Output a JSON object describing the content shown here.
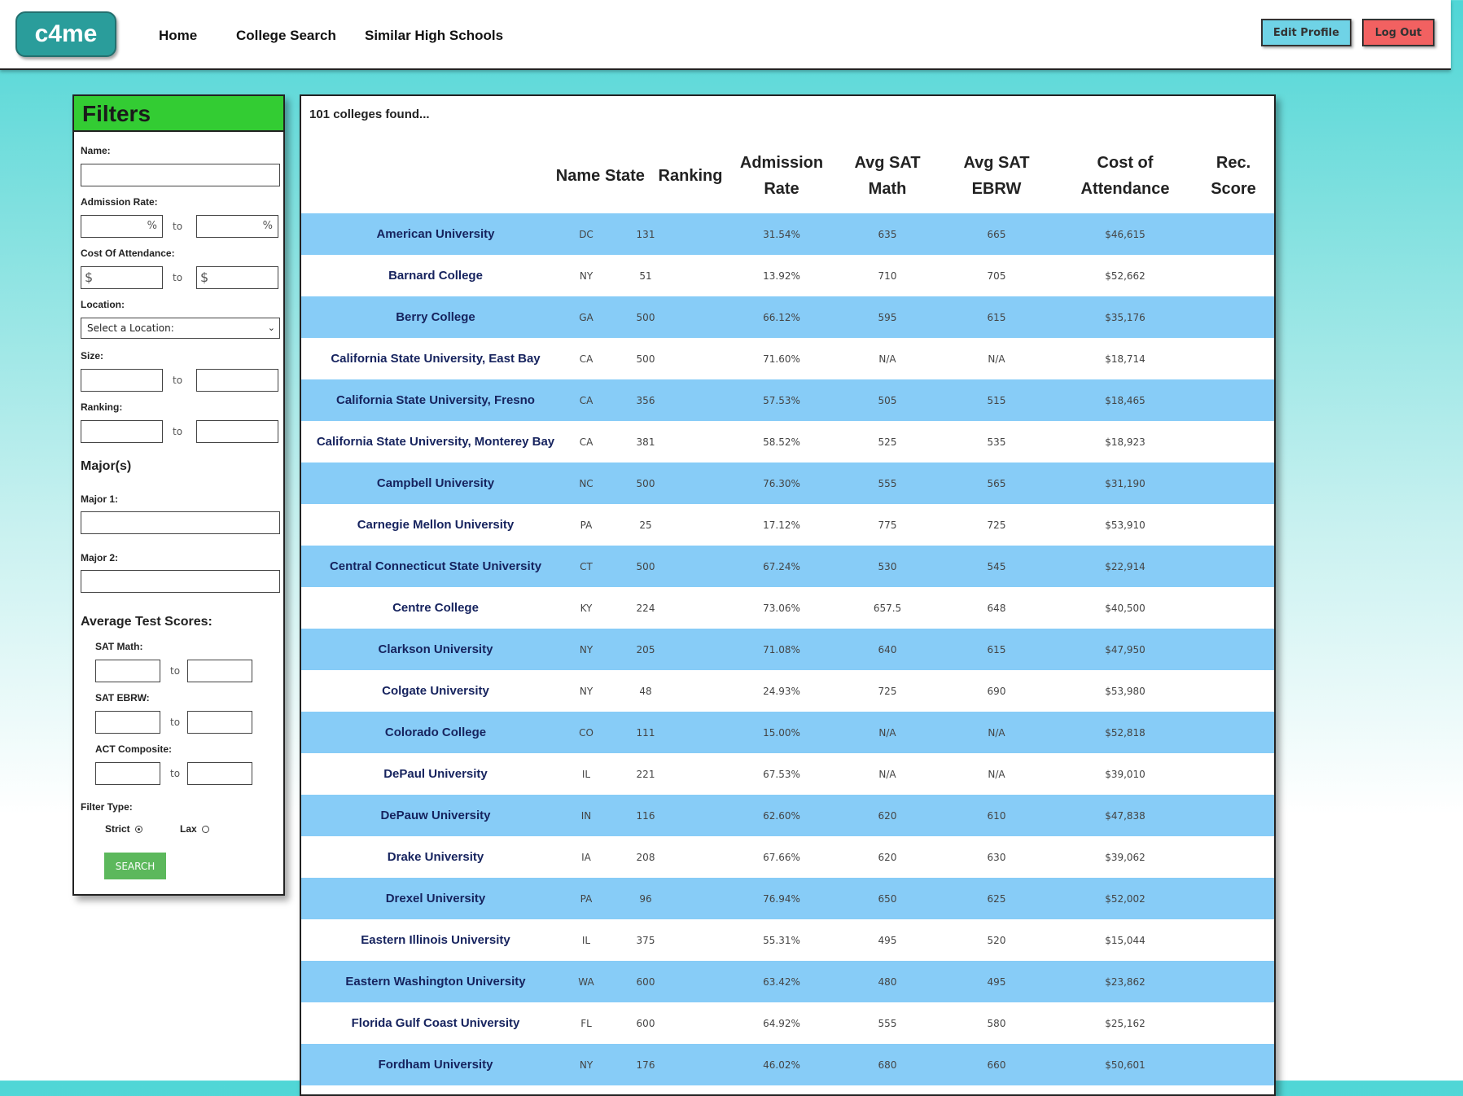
{
  "nav": {
    "logo": "c4me",
    "links": [
      "Home",
      "College Search",
      "Similar High Schools"
    ],
    "edit_profile": "Edit Profile",
    "log_out": "Log Out"
  },
  "filters": {
    "title": "Filters",
    "name_label": "Name:",
    "admission_label": "Admission Rate:",
    "percent": "%",
    "to": "to",
    "cost_label": "Cost Of Attendance:",
    "dollar": "$",
    "location_label": "Location:",
    "location_value": "Select a Location:",
    "size_label": "Size:",
    "ranking_label": "Ranking:",
    "majors_label": "Major(s)",
    "major1_label": "Major 1:",
    "major2_label": "Major 2:",
    "scores_label": "Average Test Scores:",
    "sat_math_label": "SAT Math:",
    "sat_ebrw_label": "SAT EBRW:",
    "act_label": "ACT Composite:",
    "filter_type_label": "Filter Type:",
    "strict": "Strict",
    "lax": "Lax",
    "search": "SEARCH"
  },
  "results": {
    "found": "101 colleges found...",
    "headers": {
      "name": "Name",
      "state": "State",
      "ranking": "Ranking",
      "admission1": "Admission",
      "admission2": "Rate",
      "math1": "Avg SAT",
      "math2": "Math",
      "ebrw1": "Avg SAT",
      "ebrw2": "EBRW",
      "cost1": "Cost of",
      "cost2": "Attendance",
      "rec1": "Rec.",
      "rec2": "Score"
    },
    "rows": [
      [
        "American University",
        "DC",
        "131",
        "31.54%",
        "635",
        "665",
        "$46,615",
        ""
      ],
      [
        "Barnard College",
        "NY",
        "51",
        "13.92%",
        "710",
        "705",
        "$52,662",
        ""
      ],
      [
        "Berry College",
        "GA",
        "500",
        "66.12%",
        "595",
        "615",
        "$35,176",
        ""
      ],
      [
        "California State University, East Bay",
        "CA",
        "500",
        "71.60%",
        "N/A",
        "N/A",
        "$18,714",
        ""
      ],
      [
        "California State University, Fresno",
        "CA",
        "356",
        "57.53%",
        "505",
        "515",
        "$18,465",
        ""
      ],
      [
        "California State University, Monterey Bay",
        "CA",
        "381",
        "58.52%",
        "525",
        "535",
        "$18,923",
        ""
      ],
      [
        "Campbell University",
        "NC",
        "500",
        "76.30%",
        "555",
        "565",
        "$31,190",
        ""
      ],
      [
        "Carnegie Mellon University",
        "PA",
        "25",
        "17.12%",
        "775",
        "725",
        "$53,910",
        ""
      ],
      [
        "Central Connecticut State University",
        "CT",
        "500",
        "67.24%",
        "530",
        "545",
        "$22,914",
        ""
      ],
      [
        "Centre College",
        "KY",
        "224",
        "73.06%",
        "657.5",
        "648",
        "$40,500",
        ""
      ],
      [
        "Clarkson University",
        "NY",
        "205",
        "71.08%",
        "640",
        "615",
        "$47,950",
        ""
      ],
      [
        "Colgate University",
        "NY",
        "48",
        "24.93%",
        "725",
        "690",
        "$53,980",
        ""
      ],
      [
        "Colorado College",
        "CO",
        "111",
        "15.00%",
        "N/A",
        "N/A",
        "$52,818",
        ""
      ],
      [
        "DePaul University",
        "IL",
        "221",
        "67.53%",
        "N/A",
        "N/A",
        "$39,010",
        ""
      ],
      [
        "DePauw University",
        "IN",
        "116",
        "62.60%",
        "620",
        "610",
        "$47,838",
        ""
      ],
      [
        "Drake University",
        "IA",
        "208",
        "67.66%",
        "620",
        "630",
        "$39,062",
        ""
      ],
      [
        "Drexel University",
        "PA",
        "96",
        "76.94%",
        "650",
        "625",
        "$52,002",
        ""
      ],
      [
        "Eastern Illinois University",
        "IL",
        "375",
        "55.31%",
        "495",
        "520",
        "$15,044",
        ""
      ],
      [
        "Eastern Washington University",
        "WA",
        "600",
        "63.42%",
        "480",
        "495",
        "$23,862",
        ""
      ],
      [
        "Florida Gulf Coast University",
        "FL",
        "600",
        "64.92%",
        "555",
        "580",
        "$25,162",
        ""
      ],
      [
        "Fordham University",
        "NY",
        "176",
        "46.02%",
        "680",
        "660",
        "$50,601",
        ""
      ]
    ]
  },
  "colors": {
    "row_blue": "#87ccf7",
    "filters_header": "#33cc33",
    "logo": "#2a9d9b",
    "edit_profile": "#6fd3e6",
    "log_out": "#f26161",
    "search": "#5cb85c"
  }
}
